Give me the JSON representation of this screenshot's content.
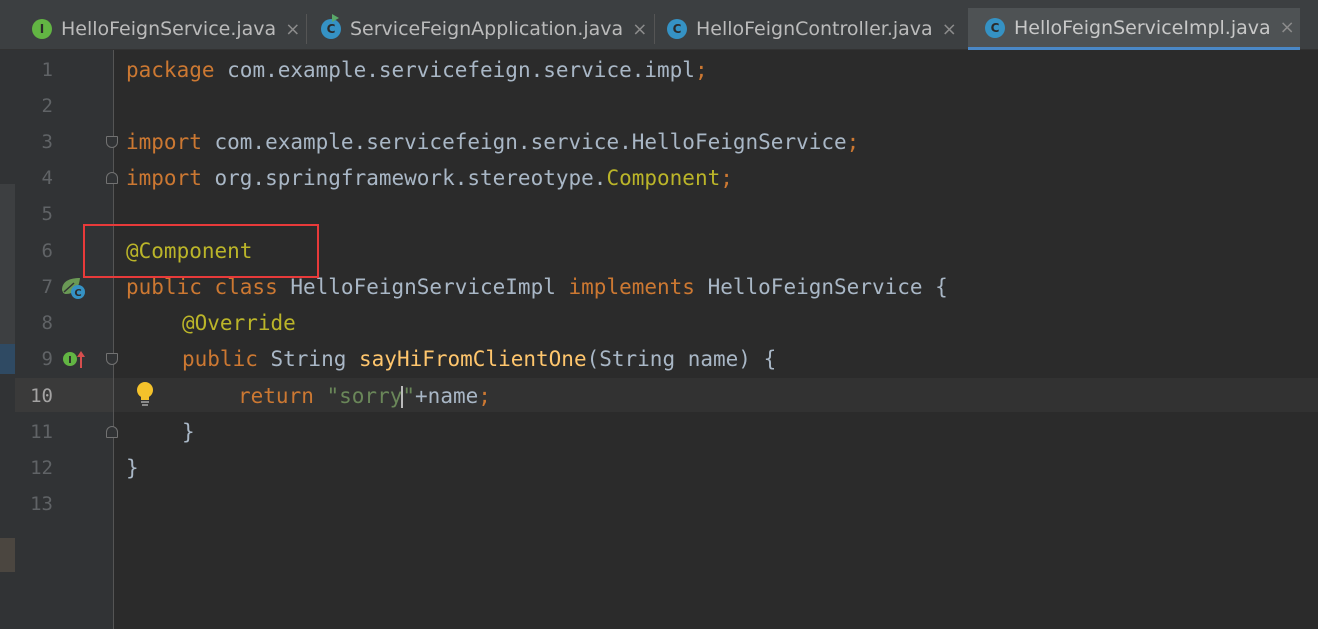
{
  "tabs": [
    {
      "label": "HelloFeignService.java",
      "type": "interface",
      "icon_letter": "I",
      "active": false
    },
    {
      "label": "ServiceFeignApplication.java",
      "type": "class-run",
      "icon_letter": "C",
      "active": false
    },
    {
      "label": "HelloFeignController.java",
      "type": "class",
      "icon_letter": "C",
      "active": false
    },
    {
      "label": "HelloFeignServiceImpl.java",
      "type": "class",
      "icon_letter": "C",
      "active": true
    }
  ],
  "tab_close_glyph": "×",
  "editor": {
    "current_line": 10,
    "line_numbers": [
      "1",
      "2",
      "3",
      "4",
      "5",
      "6",
      "7",
      "8",
      "9",
      "10",
      "11",
      "12",
      "13"
    ],
    "code": {
      "l1": {
        "kw": "package",
        "pkg": " com.example.servicefeign.service.impl",
        "semi": ";"
      },
      "l3": {
        "kw": "import",
        "pkg": " com.example.servicefeign.service.HelloFeignService",
        "semi": ";"
      },
      "l4": {
        "kw": "import",
        "pkg": " org.springframework.stereotype.",
        "cls": "Component",
        "semi": ";"
      },
      "l6": {
        "ann": "@Component"
      },
      "l7": {
        "kw1": "public",
        "kw2": " class",
        "name": " HelloFeignServiceImpl",
        "kw3": " implements",
        "iface": " HelloFeignService",
        "brace": " {"
      },
      "l8": {
        "ann": "@Override"
      },
      "l9": {
        "kw": "public",
        "type": " String",
        "fn": " sayHiFromClientOne",
        "params": "(String name) {"
      },
      "l10": {
        "kw": "return",
        "str_a": " \"sorry",
        "str_b": "\"",
        "rest": "+name",
        "semi": ";"
      },
      "l11": {
        "brace": "}"
      },
      "l12": {
        "brace": "}"
      }
    }
  },
  "colors": {
    "keyword": "#cc7832",
    "annotation": "#bbb529",
    "string": "#6a8759",
    "function": "#ffc66d",
    "text": "#a9b7c6",
    "highlight_box": "#e83a3a",
    "active_tab_underline": "#4a88c7"
  }
}
